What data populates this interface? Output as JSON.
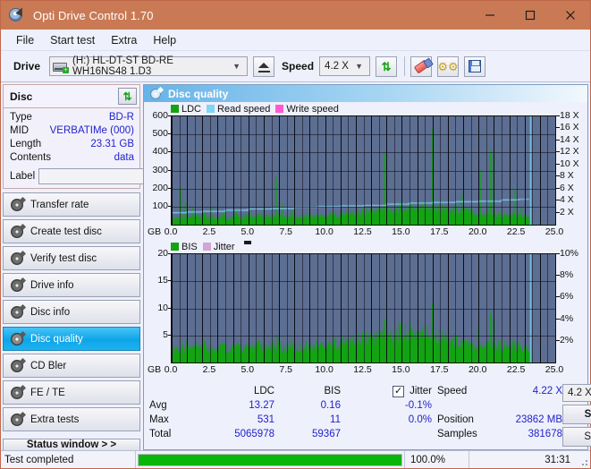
{
  "window": {
    "title": "Opti Drive Control 1.70",
    "icon": "disc-icon",
    "controls": {
      "minimize": "minimize-icon",
      "maximize": "maximize-icon",
      "close": "close-icon"
    },
    "titlebar_color": "#c97a55"
  },
  "menu": {
    "items": [
      "File",
      "Start test",
      "Extra",
      "Help"
    ]
  },
  "toolbar": {
    "drive_label": "Drive",
    "drive_value": "(H:)  HL-DT-ST BD-RE  WH16NS48 1.D3",
    "eject_icon": "eject-icon",
    "speed_label": "Speed",
    "speed_value": "4.2 X",
    "refresh_icon": "refresh-arrows-icon",
    "erase_icon": "eraser-icon",
    "settings_icon": "gears-icon",
    "save_icon": "floppy-save-icon"
  },
  "disc_panel": {
    "title": "Disc",
    "refresh_icon": "refresh-arrows-icon",
    "rows": [
      {
        "key": "Type",
        "value": "BD-R"
      },
      {
        "key": "MID",
        "value": "VERBATIMe (000)"
      },
      {
        "key": "Length",
        "value": "23.31 GB"
      },
      {
        "key": "Contents",
        "value": "data"
      }
    ],
    "label_key": "Label",
    "label_value": "",
    "label_placeholder": "",
    "disc_button_icon": "cd-disc-icon"
  },
  "sidebar": {
    "items": [
      {
        "label": "Transfer rate",
        "icon": "disc-icon",
        "active": false
      },
      {
        "label": "Create test disc",
        "icon": "disc-icon",
        "active": false
      },
      {
        "label": "Verify test disc",
        "icon": "disc-icon",
        "active": false
      },
      {
        "label": "Drive info",
        "icon": "disc-icon",
        "active": false
      },
      {
        "label": "Disc info",
        "icon": "disc-icon",
        "active": false
      },
      {
        "label": "Disc quality",
        "icon": "disc-icon",
        "active": true
      },
      {
        "label": "CD Bler",
        "icon": "disc-icon",
        "active": false
      },
      {
        "label": "FE / TE",
        "icon": "disc-icon",
        "active": false
      },
      {
        "label": "Extra tests",
        "icon": "disc-icon",
        "active": false
      }
    ],
    "status_window_button": "Status window > >"
  },
  "panel": {
    "title": "Disc quality",
    "icon": "disc-icon"
  },
  "stats": {
    "col_headers": {
      "ldc": "LDC",
      "bis": "BIS"
    },
    "jitter_label": "Jitter",
    "jitter_checked": true,
    "rows": [
      {
        "label": "Avg",
        "ldc": "13.27",
        "bis": "0.16",
        "jitter": "-0.1%"
      },
      {
        "label": "Max",
        "ldc": "531",
        "bis": "11",
        "jitter": "0.0%"
      },
      {
        "label": "Total",
        "ldc": "5065978",
        "bis": "59367",
        "jitter": ""
      }
    ],
    "speed_label": "Speed",
    "speed_value": "4.22 X",
    "position_label": "Position",
    "position_value": "23862 MB",
    "samples_label": "Samples",
    "samples_value": "381678",
    "speed_select": "4.2 X",
    "start_full_label": "Start full",
    "start_part_label": "Start part"
  },
  "statusbar": {
    "text": "Test completed",
    "percent": "100.0%",
    "progress": 100,
    "time": "31:31",
    "progress_color": "#0ab50a"
  },
  "chart_data": [
    {
      "type": "line",
      "name": "ldc-chart",
      "title": "",
      "legend": [
        {
          "label": "LDC",
          "color": "#13a313"
        },
        {
          "label": "Read speed",
          "color": "#7fd4f7"
        },
        {
          "label": "Write speed",
          "color": "#ff5ad2"
        }
      ],
      "legend_position": "top-left",
      "xlabel": "GB",
      "x": [
        0.0,
        2.5,
        5.0,
        7.5,
        10.0,
        12.5,
        15.0,
        17.5,
        20.0,
        22.5,
        25.0
      ],
      "xlim": [
        0,
        25
      ],
      "xticks": [
        "0.0",
        "2.5",
        "5.0",
        "7.5",
        "10.0",
        "12.5",
        "15.0",
        "17.5",
        "20.0",
        "22.5",
        "25.0"
      ],
      "ylabel": "LDC",
      "ylim": [
        0,
        600
      ],
      "yticks": [
        100,
        200,
        300,
        400,
        500,
        600
      ],
      "y2label": "Speed",
      "y2lim": [
        0,
        18
      ],
      "y2ticks": [
        "2 X",
        "4 X",
        "6 X",
        "8 X",
        "10 X",
        "12 X",
        "14 X",
        "16 X",
        "18 X"
      ],
      "grid": true,
      "plot_bg": "#5c6e92",
      "data_end_gb": 23.4,
      "series": [
        {
          "name": "LDC",
          "color": "#13a313",
          "type": "area-spikes",
          "baseline": [
            20,
            26,
            22,
            30,
            24,
            28,
            25,
            33,
            28,
            24,
            27,
            31,
            26,
            24,
            29,
            26,
            30,
            27,
            25,
            29,
            33,
            28,
            26,
            31,
            27,
            30,
            28,
            34,
            29,
            32,
            30,
            28,
            33,
            31,
            35,
            33,
            38,
            36,
            41,
            39,
            44,
            42,
            48,
            46,
            52,
            50,
            55,
            53,
            58,
            56,
            60,
            58,
            62,
            61,
            64,
            63,
            66,
            64,
            62,
            60,
            58,
            56,
            54,
            52,
            50,
            48,
            46,
            44,
            42,
            40,
            38,
            37,
            36,
            35,
            34,
            33,
            32,
            31,
            30,
            30
          ],
          "spikes": [
            {
              "x": 0.6,
              "y": 205
            },
            {
              "x": 0.9,
              "y": 118
            },
            {
              "x": 1.4,
              "y": 92
            },
            {
              "x": 2.0,
              "y": 78
            },
            {
              "x": 2.6,
              "y": 96
            },
            {
              "x": 3.4,
              "y": 74
            },
            {
              "x": 4.2,
              "y": 86
            },
            {
              "x": 5.1,
              "y": 70
            },
            {
              "x": 6.0,
              "y": 100
            },
            {
              "x": 6.8,
              "y": 262
            },
            {
              "x": 7.2,
              "y": 112
            },
            {
              "x": 7.9,
              "y": 80
            },
            {
              "x": 9.0,
              "y": 68
            },
            {
              "x": 10.4,
              "y": 72
            },
            {
              "x": 11.6,
              "y": 66
            },
            {
              "x": 13.9,
              "y": 398
            },
            {
              "x": 14.6,
              "y": 80
            },
            {
              "x": 15.4,
              "y": 76
            },
            {
              "x": 17.0,
              "y": 531
            },
            {
              "x": 17.4,
              "y": 104
            },
            {
              "x": 18.9,
              "y": 170
            },
            {
              "x": 20.1,
              "y": 300
            },
            {
              "x": 20.6,
              "y": 108
            },
            {
              "x": 20.8,
              "y": 415
            },
            {
              "x": 21.0,
              "y": 390
            },
            {
              "x": 22.4,
              "y": 195
            },
            {
              "x": 22.8,
              "y": 96
            }
          ]
        },
        {
          "name": "Read speed",
          "color": "#7fd4f7",
          "type": "step-line",
          "points": [
            {
              "x": 0.0,
              "y": 2.0
            },
            {
              "x": 1.0,
              "y": 2.1
            },
            {
              "x": 2.0,
              "y": 2.2
            },
            {
              "x": 3.5,
              "y": 2.4
            },
            {
              "x": 5.0,
              "y": 2.6
            },
            {
              "x": 6.5,
              "y": 2.7
            },
            {
              "x": 8.0,
              "y": 2.9
            },
            {
              "x": 9.5,
              "y": 3.0
            },
            {
              "x": 11.0,
              "y": 3.1
            },
            {
              "x": 12.5,
              "y": 3.2
            },
            {
              "x": 14.0,
              "y": 3.4
            },
            {
              "x": 15.5,
              "y": 3.6
            },
            {
              "x": 17.0,
              "y": 3.7
            },
            {
              "x": 18.5,
              "y": 3.8
            },
            {
              "x": 20.0,
              "y": 3.9
            },
            {
              "x": 21.5,
              "y": 4.1
            },
            {
              "x": 22.6,
              "y": 4.2
            },
            {
              "x": 23.3,
              "y": 4.2
            }
          ]
        },
        {
          "name": "End marker",
          "color": "#7fd4f7",
          "type": "vline",
          "x": 23.4
        }
      ]
    },
    {
      "type": "line",
      "name": "bis-chart",
      "title": "",
      "legend": [
        {
          "label": "BIS",
          "color": "#13a313"
        },
        {
          "label": "Jitter",
          "color": "#cfa6d8"
        }
      ],
      "legend_position": "top-left",
      "xlabel": "GB",
      "xlim": [
        0,
        25
      ],
      "xticks": [
        "0.0",
        "2.5",
        "5.0",
        "7.5",
        "10.0",
        "12.5",
        "15.0",
        "17.5",
        "20.0",
        "22.5",
        "25.0"
      ],
      "ylabel": "BIS",
      "ylim": [
        0,
        20
      ],
      "yticks": [
        5,
        10,
        15,
        20
      ],
      "y2label": "Jitter",
      "y2lim": [
        0,
        10
      ],
      "y2ticks": [
        "2%",
        "4%",
        "6%",
        "8%",
        "10%"
      ],
      "grid": true,
      "plot_bg": "#5c6e92",
      "data_end_gb": 23.4,
      "series": [
        {
          "name": "BIS",
          "color": "#13a313",
          "type": "area-spikes",
          "baseline": [
            1.4,
            1.9,
            1.5,
            2.1,
            1.6,
            1.8,
            1.5,
            2.0,
            1.7,
            1.5,
            1.9,
            2.2,
            1.6,
            1.8,
            1.7,
            2.0,
            1.6,
            1.9,
            1.7,
            2.1,
            1.8,
            1.6,
            2.0,
            1.7,
            1.9,
            1.6,
            2.1,
            1.8,
            1.7,
            2.0,
            1.9,
            1.7,
            2.2,
            2.0,
            2.3,
            2.1,
            2.5,
            2.3,
            2.6,
            2.4,
            2.8,
            2.6,
            3.0,
            2.8,
            3.2,
            3.0,
            3.4,
            3.2,
            3.5,
            3.3,
            3.6,
            3.4,
            3.7,
            3.5,
            3.6,
            3.4,
            3.5,
            3.3,
            3.2,
            3.0,
            2.9,
            2.7,
            2.6,
            2.4,
            2.3,
            2.1,
            2.0,
            2.2,
            2.1,
            2.3,
            2.2,
            2.0,
            2.1,
            1.9,
            2.0,
            1.8,
            1.9,
            1.7,
            1.8,
            1.6
          ],
          "spikes": [
            {
              "x": 0.7,
              "y": 3.4
            },
            {
              "x": 1.9,
              "y": 3.2
            },
            {
              "x": 3.1,
              "y": 3.0
            },
            {
              "x": 4.4,
              "y": 3.3
            },
            {
              "x": 6.9,
              "y": 5.0
            },
            {
              "x": 8.0,
              "y": 3.4
            },
            {
              "x": 10.2,
              "y": 3.8
            },
            {
              "x": 11.4,
              "y": 3.9
            },
            {
              "x": 12.6,
              "y": 4.2
            },
            {
              "x": 13.3,
              "y": 4.4
            },
            {
              "x": 13.9,
              "y": 8.1
            },
            {
              "x": 14.6,
              "y": 4.6
            },
            {
              "x": 15.2,
              "y": 5.2
            },
            {
              "x": 16.4,
              "y": 4.8
            },
            {
              "x": 17.0,
              "y": 11.0
            },
            {
              "x": 17.6,
              "y": 5.0
            },
            {
              "x": 18.3,
              "y": 4.4
            },
            {
              "x": 20.0,
              "y": 7.0
            },
            {
              "x": 20.8,
              "y": 9.2
            },
            {
              "x": 21.0,
              "y": 8.1
            },
            {
              "x": 22.3,
              "y": 4.3
            }
          ]
        },
        {
          "name": "End marker",
          "color": "#7fd4f7",
          "type": "vline",
          "x": 23.4
        }
      ]
    }
  ]
}
